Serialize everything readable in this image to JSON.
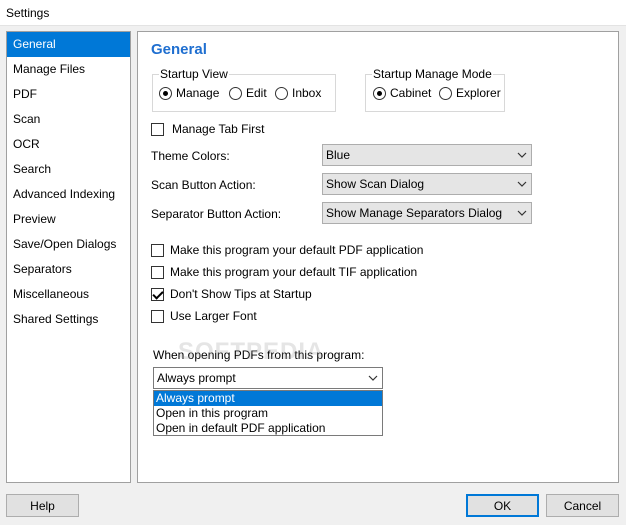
{
  "window": {
    "title": "Settings"
  },
  "sidebar": {
    "items": [
      {
        "label": "General",
        "selected": true
      },
      {
        "label": "Manage Files"
      },
      {
        "label": "PDF"
      },
      {
        "label": "Scan"
      },
      {
        "label": "OCR"
      },
      {
        "label": "Search"
      },
      {
        "label": "Advanced Indexing"
      },
      {
        "label": "Preview"
      },
      {
        "label": "Save/Open Dialogs"
      },
      {
        "label": "Separators"
      },
      {
        "label": "Miscellaneous"
      },
      {
        "label": "Shared Settings"
      }
    ]
  },
  "panel": {
    "title": "General",
    "startup_view": {
      "label": "Startup View",
      "options": [
        "Manage",
        "Edit",
        "Inbox"
      ],
      "selected": "Manage"
    },
    "startup_manage_mode": {
      "label": "Startup Manage Mode",
      "options": [
        "Cabinet",
        "Explorer"
      ],
      "selected": "Cabinet"
    },
    "manage_tab_first": {
      "label": "Manage Tab First",
      "checked": false
    },
    "theme_colors": {
      "label": "Theme Colors:",
      "value": "Blue"
    },
    "scan_button_action": {
      "label": "Scan Button Action:",
      "value": "Show Scan Dialog"
    },
    "separator_button_action": {
      "label": "Separator Button Action:",
      "value": "Show Manage Separators Dialog"
    },
    "checkboxes": [
      {
        "label": "Make this program your default PDF application",
        "checked": false
      },
      {
        "label": "Make this program your default TIF application",
        "checked": false
      },
      {
        "label": "Don't Show Tips at Startup",
        "checked": true
      },
      {
        "label": "Use Larger Font",
        "checked": false
      }
    ],
    "pdf_open": {
      "label": "When opening PDFs from this program:",
      "value": "Always prompt",
      "options": [
        "Always prompt",
        "Open in this program",
        "Open in default PDF application"
      ],
      "highlighted": "Always prompt"
    }
  },
  "watermark": "SOFTPEDIA",
  "footer": {
    "help_label": "Help",
    "ok_label": "OK",
    "cancel_label": "Cancel"
  },
  "colors": {
    "accent": "#0078d7",
    "title": "#1f6fd0"
  }
}
